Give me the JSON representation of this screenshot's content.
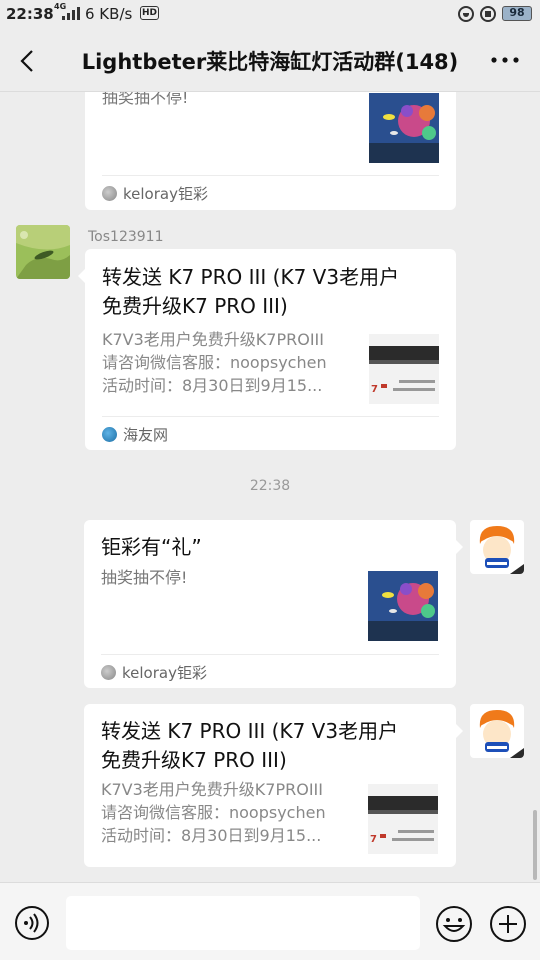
{
  "status_bar": {
    "time": "22:38",
    "network": "4G",
    "speed": "6 KB/s",
    "hd": "HD",
    "battery": "98"
  },
  "header": {
    "title": "Lightbeter莱比特海缸灯活动群(148)"
  },
  "messages": {
    "m1": {
      "title": "",
      "desc_lines": [
        "抽奖抽不停!"
      ],
      "source": "keloray钜彩",
      "source_icon": "keloray-logo-icon"
    },
    "m2": {
      "sender": "Tos123911",
      "title_lines": [
        "转发送 K7 PRO III (K7 V3老用户",
        "免费升级K7 PRO III)"
      ],
      "desc_lines": [
        "K7V3老用户免费升级K7PROIII",
        "请咨询微信客服：noopsychen",
        "活动时间：8月30日到9月15..."
      ],
      "source": "海友网",
      "source_icon": "haiyou-logo-icon"
    },
    "timestamp": "22:38",
    "m3": {
      "title_lines": [
        "钜彩有“礼”"
      ],
      "desc_lines": [
        "抽奖抽不停!"
      ],
      "source": "keloray钜彩",
      "source_icon": "keloray-logo-icon"
    },
    "m4": {
      "title_lines": [
        "转发送 K7 PRO III (K7 V3老用户",
        "免费升级K7 PRO III)"
      ],
      "desc_lines": [
        "K7V3老用户免费升级K7PROIII",
        "请咨询微信客服：noopsychen",
        "活动时间：8月30日到9月15..."
      ],
      "source_icon": "none"
    }
  },
  "input_bar": {
    "placeholder": "",
    "voice_icon": "voice-icon",
    "emoji_icon": "emoji-icon",
    "plus_icon": "plus-icon"
  },
  "colors": {
    "background": "#ededed",
    "bubble": "#ffffff",
    "secondary_text": "#888888"
  }
}
